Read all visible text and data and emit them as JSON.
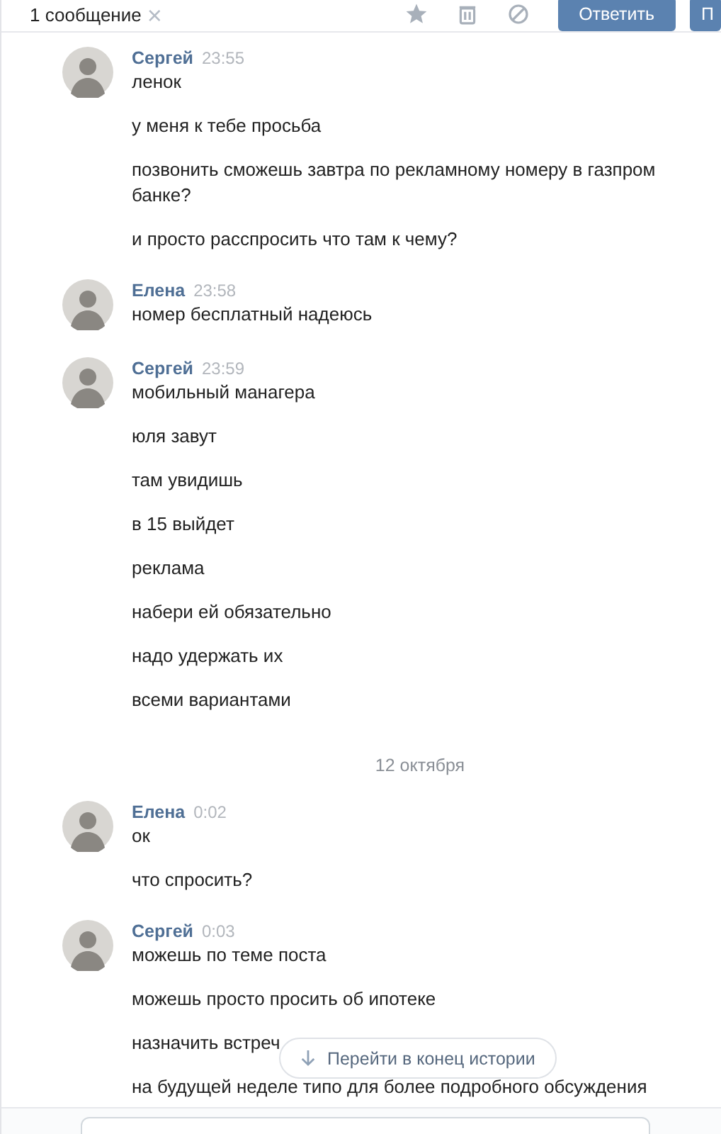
{
  "header": {
    "title": "1 сообщение",
    "close": "×",
    "buttons": [
      "Ответить",
      "П"
    ]
  },
  "messages": [
    {
      "kind": "group",
      "author": "Сергей",
      "time": "23:55",
      "texts": [
        "ленок",
        "у меня к тебе просьба",
        "позвонить сможешь завтра по рекламному номеру в газпром банке?",
        "и просто расспросить что там к чему?"
      ]
    },
    {
      "kind": "group",
      "author": "Елена",
      "time": "23:58",
      "texts": [
        "номер бесплатный надеюсь"
      ]
    },
    {
      "kind": "group",
      "author": "Сергей",
      "time": "23:59",
      "texts": [
        "мобильный манагера",
        "юля завут",
        "там увидишь",
        "в 15 выйдет",
        "реклама",
        "набери ей обязательно",
        "надо удержать их",
        "всеми вариантами"
      ]
    },
    {
      "kind": "date",
      "text": "12 октября"
    },
    {
      "kind": "group",
      "author": "Елена",
      "time": "0:02",
      "texts": [
        "ок",
        "что спросить?"
      ]
    },
    {
      "kind": "group",
      "author": "Сергей",
      "time": "0:03",
      "texts": [
        "можешь по теме поста",
        "можешь просто просить об ипотеке",
        "назначить встреч",
        "на будущей неделе типо для более подробного обсуждения"
      ]
    }
  ],
  "scroll_button": {
    "label": "Перейти в конец истории"
  }
}
